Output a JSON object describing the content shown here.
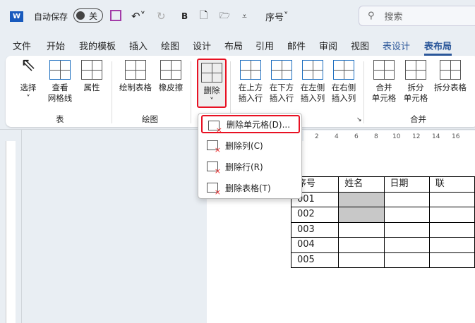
{
  "titlebar": {
    "autosave_label": "自动保存",
    "autosave_state": "关",
    "doc_title": "序号",
    "search_placeholder": "搜索",
    "word_icon": "W"
  },
  "tabs": [
    "文件",
    "开始",
    "我的模板",
    "插入",
    "绘图",
    "设计",
    "布局",
    "引用",
    "邮件",
    "审阅",
    "视图",
    "表设计",
    "表布局"
  ],
  "ribbon": {
    "buttons": [
      {
        "label": "选择",
        "sub": "˅"
      },
      {
        "label": "查看",
        "sub": "网格线"
      },
      {
        "label": "属性"
      },
      {
        "label": "绘制表格"
      },
      {
        "label": "橡皮擦"
      },
      {
        "label": "删除",
        "sub": "˅"
      },
      {
        "label": "在上方",
        "sub": "插入行"
      },
      {
        "label": "在下方",
        "sub": "插入行"
      },
      {
        "label": "在左侧",
        "sub": "插入列"
      },
      {
        "label": "在右侧",
        "sub": "插入列"
      },
      {
        "label": "合并",
        "sub": "单元格"
      },
      {
        "label": "拆分",
        "sub": "单元格"
      },
      {
        "label": "拆分表格"
      }
    ],
    "groups": [
      "表",
      "绘图",
      "合并"
    ]
  },
  "menu": [
    {
      "label": "删除单元格(D)..."
    },
    {
      "label": "删除列(C)"
    },
    {
      "label": "删除行(R)"
    },
    {
      "label": "删除表格(T)"
    }
  ],
  "ruler": [
    "2",
    "4",
    "6",
    "8",
    "10",
    "12",
    "14",
    "16"
  ],
  "table": {
    "headers": [
      "序号",
      "姓名",
      "日期",
      "联"
    ],
    "rows": [
      [
        "001",
        "",
        "",
        ""
      ],
      [
        "002",
        "",
        "",
        ""
      ],
      [
        "003",
        "",
        "",
        ""
      ],
      [
        "004",
        "",
        "",
        ""
      ],
      [
        "005",
        "",
        "",
        ""
      ]
    ]
  },
  "colors": {
    "accent": "#2b579a",
    "highlight": "#e81123",
    "selected_cell": "#c8c8c8"
  }
}
